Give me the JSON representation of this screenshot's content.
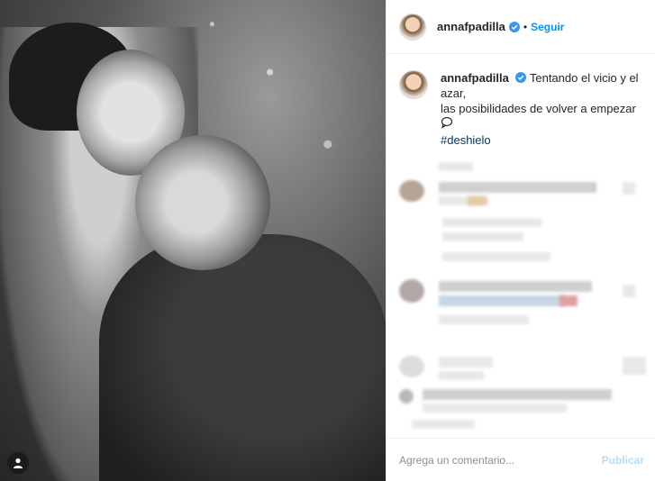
{
  "post": {
    "username": "annafpadilla",
    "separator": "•",
    "follow_label": "Seguir"
  },
  "caption": {
    "username": "annafpadilla",
    "line1": "Tentando el vicio y el azar,",
    "line2": "las posibilidades de volver a empezar",
    "hashtag": "#deshielo"
  },
  "comment_box": {
    "placeholder": "Agrega un comentario...",
    "publish_label": "Publicar"
  },
  "colors": {
    "accent": "#0095f6",
    "hashtag": "#00376b",
    "publish_disabled": "#b2dffc"
  },
  "icons": {
    "verified": "verified-badge-icon",
    "speech": "speech-bubble-icon",
    "photo_badge": "user-tag-icon"
  }
}
